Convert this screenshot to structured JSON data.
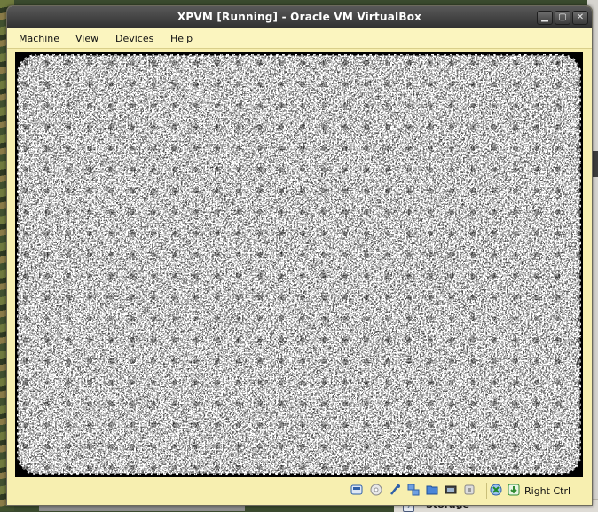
{
  "window": {
    "title": "XPVM [Running] - Oracle VM VirtualBox"
  },
  "menu": {
    "items": [
      "Machine",
      "View",
      "Devices",
      "Help"
    ]
  },
  "status_bar": {
    "host_key_label": "Right Ctrl",
    "icons": [
      "hard-disk-icon",
      "optical-drive-icon",
      "usb-icon",
      "network-icon",
      "shared-folder-icon",
      "display-icon",
      "video-capture-icon",
      "mouse-integration-icon",
      "host-key-icon"
    ]
  },
  "background_panel": {
    "storage_label": "Storage"
  },
  "colors": {
    "window_bg": "#f7efb0",
    "titlebar": "#3a3a3a",
    "screen_bg": "#000000",
    "screen_fg": "#ffffff"
  }
}
